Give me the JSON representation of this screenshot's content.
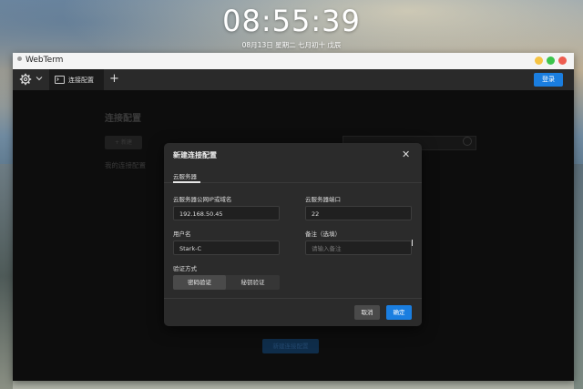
{
  "desktop": {
    "time": "08:55:39",
    "date": "08月13日  星期二  七月初十  戊辰"
  },
  "window": {
    "title": "WebTerm",
    "controls": {
      "minimize_color": "#f6c342",
      "maximize_color": "#3cc44b",
      "close_color": "#ee5d50"
    }
  },
  "toolbar": {
    "menu_icon": "settings-gear-icon",
    "tabs": [
      {
        "label": "连接配置",
        "icon": "terminal-icon"
      }
    ],
    "add_tab_icon": "plus-icon",
    "login_label": "登录",
    "accent_color": "#1a7ee0"
  },
  "background_page": {
    "title": "连接配置",
    "add_label": "+ 新建",
    "my_configs_label": "我的连接配置",
    "search_icon": "search-icon",
    "new_connection_label": "新建连接配置"
  },
  "modal": {
    "title": "新建连接配置",
    "close_icon": "close-icon",
    "tab": "云服务器",
    "fields": {
      "host": {
        "label": "云服务器公网IP或域名",
        "value": "192.168.50.45"
      },
      "port": {
        "label": "云服务器端口",
        "value": "22"
      },
      "username": {
        "label": "用户名",
        "value": "Stark-C"
      },
      "note": {
        "label": "备注（选填）",
        "placeholder": "请输入备注"
      }
    },
    "auth": {
      "label": "验证方式",
      "options": [
        "密码验证",
        "秘钥验证"
      ],
      "selected": "密码验证"
    },
    "cancel_label": "取消",
    "ok_label": "确定"
  }
}
